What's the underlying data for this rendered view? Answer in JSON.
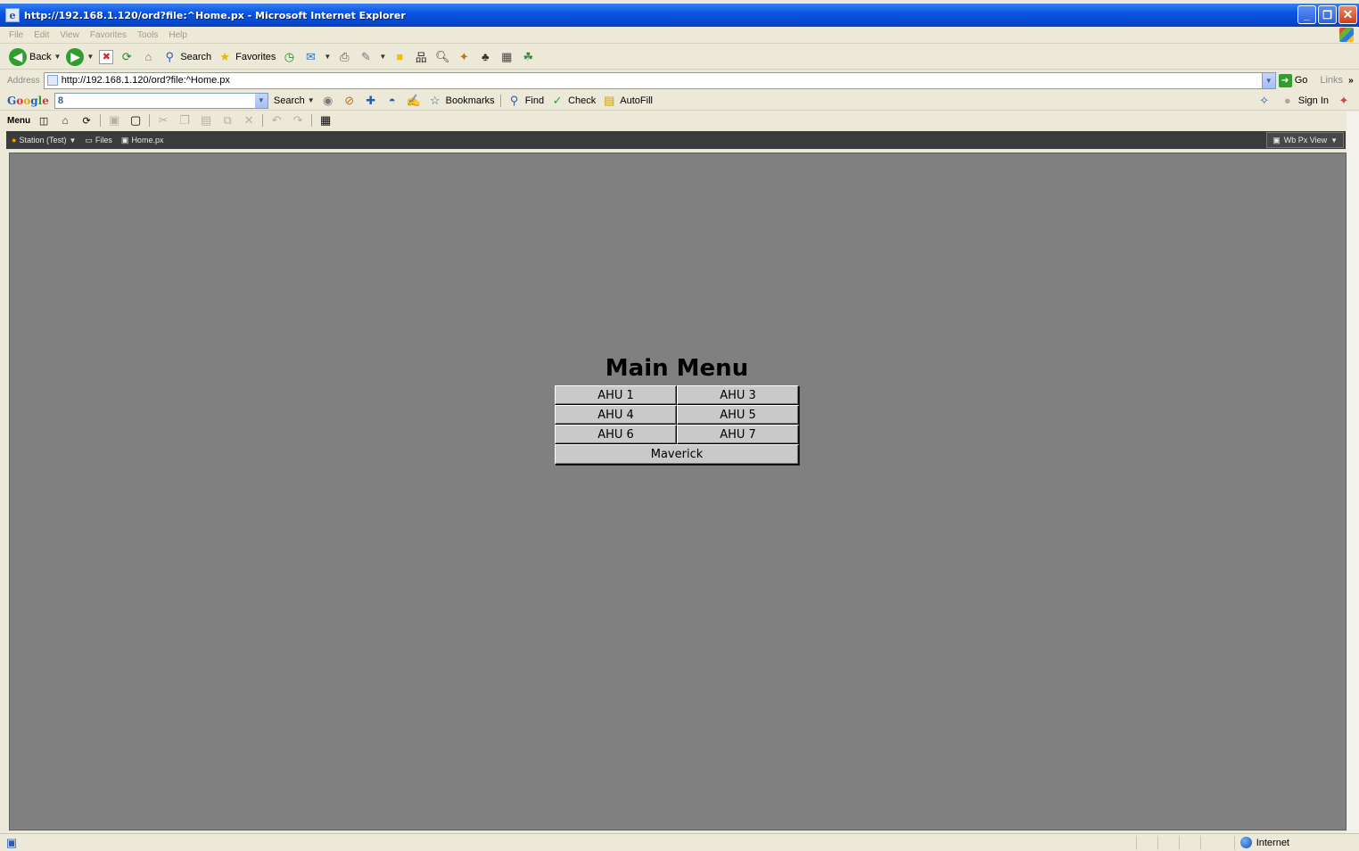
{
  "window": {
    "title": "http://192.168.1.120/ord?file:^Home.px - Microsoft Internet Explorer"
  },
  "menubar": [
    "File",
    "Edit",
    "View",
    "Favorites",
    "Tools",
    "Help"
  ],
  "toolbar": {
    "back": "Back",
    "search": "Search",
    "favorites": "Favorites"
  },
  "address": {
    "label": "Address",
    "url": "http://192.168.1.120/ord?file:^Home.px",
    "go": "Go",
    "links": "Links"
  },
  "google": {
    "logo": "Google",
    "search_box": "8",
    "search": "Search",
    "bookmarks": "Bookmarks",
    "find": "Find",
    "check": "Check",
    "autofill": "AutoFill",
    "sign_in": "Sign In"
  },
  "wbmenu": {
    "menu": "Menu"
  },
  "path": {
    "station": "Station (Test)",
    "files": "Files",
    "page": "Home.px",
    "view": "Wb Px View"
  },
  "main": {
    "heading": "Main Menu",
    "buttons": [
      "AHU 1",
      "AHU 3",
      "AHU 4",
      "AHU 5",
      "AHU 6",
      "AHU 7"
    ],
    "wide_button": "Maverick"
  },
  "status": {
    "zone": "Internet"
  }
}
